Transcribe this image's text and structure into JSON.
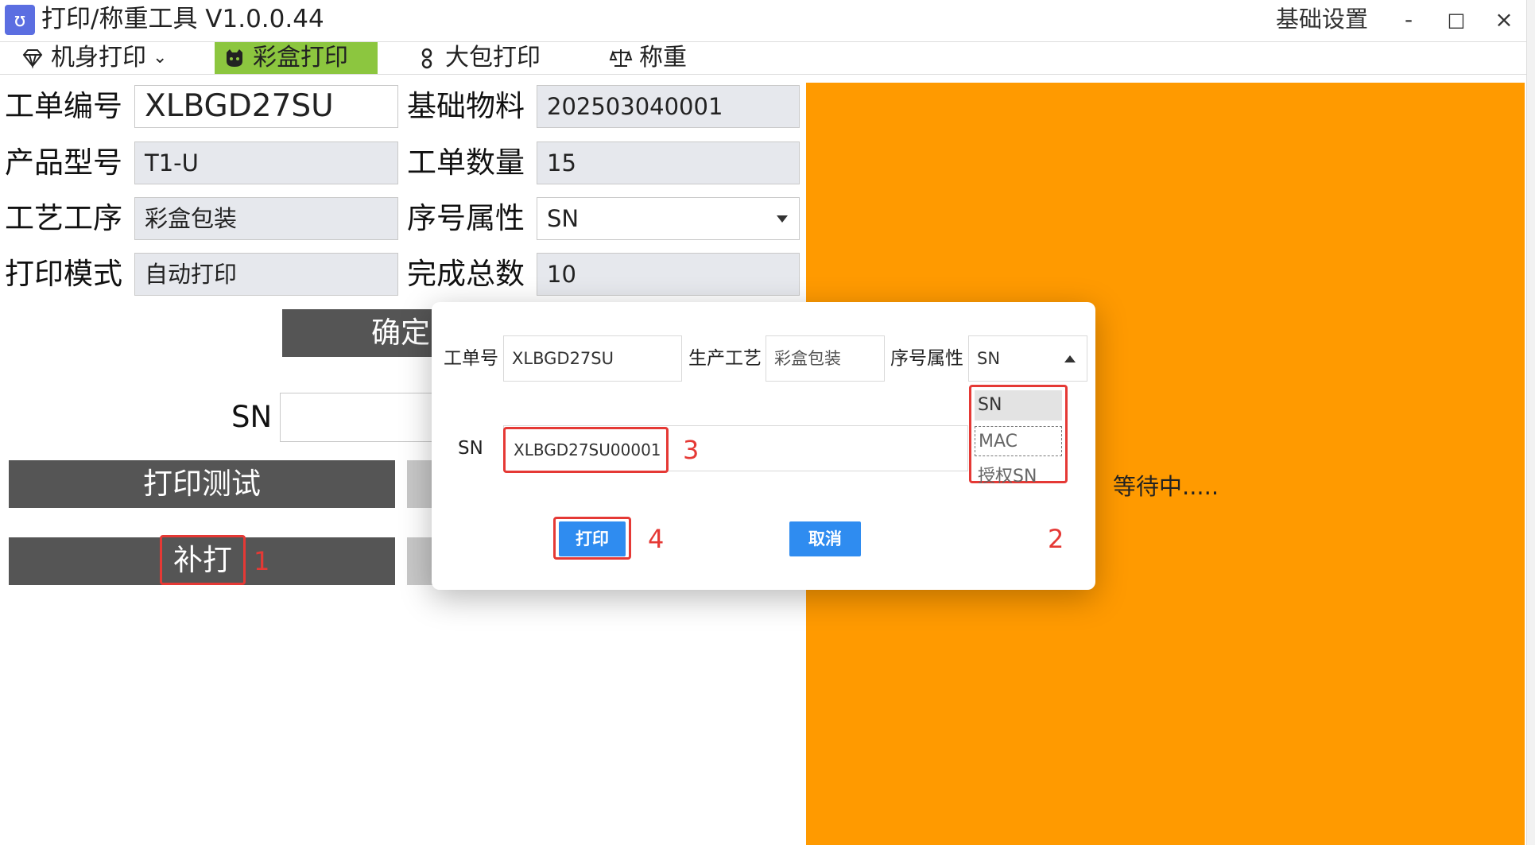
{
  "window": {
    "title": "打印/称重工具 V1.0.0.44",
    "settings": "基础设置",
    "minimize": "-",
    "maximize": "□",
    "close": "×"
  },
  "tabs": [
    {
      "label": "机身打印",
      "icon": "diamond-icon",
      "chevron": "⌄"
    },
    {
      "label": "彩盒打印",
      "icon": "github-cat-icon",
      "active": true
    },
    {
      "label": "大包打印",
      "icon": "person-icon"
    },
    {
      "label": "称重",
      "icon": "balance-scale-icon"
    }
  ],
  "form": {
    "order_no_label": "工单编号",
    "order_no_value": "XLBGD27SU",
    "material_label": "基础物料",
    "material_value": "202503040001",
    "model_label": "产品型号",
    "model_value": "T1-U",
    "qty_label": "工单数量",
    "qty_value": "15",
    "process_label": "工艺工序",
    "process_value": "彩盒包装",
    "serial_attr_label": "序号属性",
    "serial_attr_value": "SN",
    "print_mode_label": "打印模式",
    "print_mode_value": "自动打印",
    "done_total_label": "完成总数",
    "done_total_value": "10",
    "confirm_button": "确定",
    "sn_label": "SN",
    "print_test_button": "打印测试",
    "reprint_button": "补打",
    "marker_1": "1"
  },
  "status": {
    "waiting": "等待中....."
  },
  "dialog": {
    "order_label": "工单号",
    "order_value": "XLBGD27SU",
    "process_label": "生产工艺",
    "process_value": "彩盒包装",
    "serial_attr_label": "序号属性",
    "serial_attr_value": "SN",
    "options": [
      "SN",
      "MAC",
      "授权SN"
    ],
    "sn_label": "SN",
    "sn_value": "XLBGD27SU00001",
    "print_button": "打印",
    "cancel_button": "取消",
    "marker_2": "2",
    "marker_3": "3",
    "marker_4": "4"
  },
  "colors": {
    "tab_active": "#8cc63f",
    "panel": "#ff9a00",
    "button_dark": "#555555",
    "button_blue": "#2f8cf0",
    "highlight_red": "#e53935"
  }
}
